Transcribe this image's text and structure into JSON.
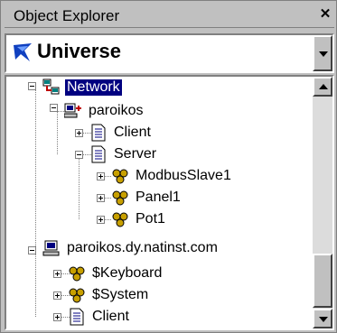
{
  "window": {
    "title": "Object Explorer",
    "close_glyph": "✕"
  },
  "combo": {
    "value": "Universe",
    "icon": "universe-icon"
  },
  "tree": {
    "items": [
      {
        "label": "Network",
        "icon": "network-icon",
        "expanded": true,
        "selected": true
      },
      {
        "label": "paroikos",
        "icon": "computer-network-icon",
        "expanded": true
      },
      {
        "label": "Client",
        "icon": "document-icon",
        "expanded": false
      },
      {
        "label": "Server",
        "icon": "document-icon",
        "expanded": true
      },
      {
        "label": "ModbusSlave1",
        "icon": "process-icon",
        "expanded": false
      },
      {
        "label": "Panel1",
        "icon": "process-icon",
        "expanded": false
      },
      {
        "label": "Pot1",
        "icon": "process-icon",
        "expanded": false
      },
      {
        "label": "paroikos.dy.natinst.com",
        "icon": "computer-icon",
        "expanded": true
      },
      {
        "label": "$Keyboard",
        "icon": "process-icon",
        "expanded": false
      },
      {
        "label": "$System",
        "icon": "process-icon",
        "expanded": false
      },
      {
        "label": "Client",
        "icon": "document-icon",
        "expanded": false
      }
    ]
  },
  "colors": {
    "selection": "#000080",
    "face": "#c0c0c0"
  }
}
